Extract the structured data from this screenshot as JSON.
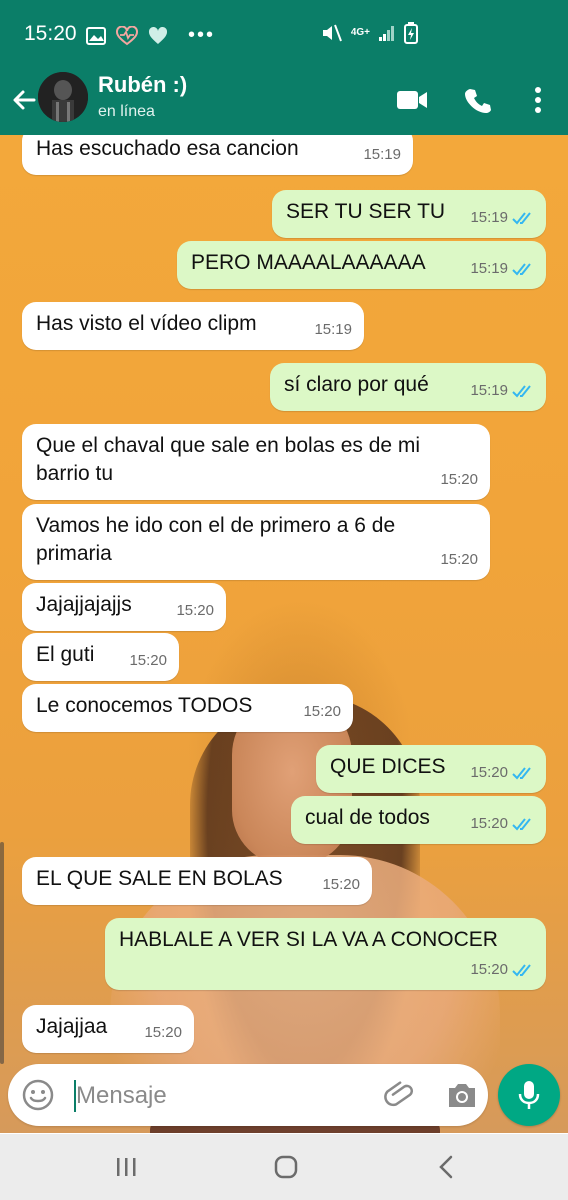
{
  "status_bar": {
    "time": "15:20",
    "network": "4G+",
    "colors": {
      "bar": "#0b7e68"
    }
  },
  "header": {
    "contact_name": "Rubén :)",
    "status": "en línea"
  },
  "messages": [
    {
      "direction": "in",
      "text": "Has escuchado esa cancion",
      "time": "15:19"
    },
    {
      "direction": "out",
      "text": "SER TU SER TU",
      "time": "15:19",
      "read": true
    },
    {
      "direction": "out",
      "text": "PERO MAAAALAAAAAA",
      "time": "15:19",
      "read": true
    },
    {
      "direction": "in",
      "text": "Has visto el vídeo clipm",
      "time": "15:19"
    },
    {
      "direction": "out",
      "text": "sí claro por qué",
      "time": "15:19",
      "read": true
    },
    {
      "direction": "in",
      "text": "Que el chaval que sale en bolas es de mi barrio tu",
      "time": "15:20"
    },
    {
      "direction": "in",
      "text": "Vamos he ido con el de primero a 6 de primaria",
      "time": "15:20"
    },
    {
      "direction": "in",
      "text": "Jajajjajajjs",
      "time": "15:20"
    },
    {
      "direction": "in",
      "text": "El guti",
      "time": "15:20"
    },
    {
      "direction": "in",
      "text": "Le conocemos TODOS",
      "time": "15:20"
    },
    {
      "direction": "out",
      "text": "QUE DICES",
      "time": "15:20",
      "read": true
    },
    {
      "direction": "out",
      "text": "cual de todos",
      "time": "15:20",
      "read": true
    },
    {
      "direction": "in",
      "text": "EL QUE SALE EN BOLAS",
      "time": "15:20"
    },
    {
      "direction": "out",
      "text": "HABLALE A VER SI LA VA A CONOCER",
      "time": "15:20",
      "read": true
    },
    {
      "direction": "in",
      "text": "Jajajjaa",
      "time": "15:20"
    }
  ],
  "composer": {
    "placeholder": "Mensaje"
  },
  "icons": {
    "header": [
      "back-arrow-icon",
      "video-call-icon",
      "phone-icon",
      "more-vert-icon"
    ],
    "composer": [
      "emoji-icon",
      "attach-icon",
      "camera-icon",
      "mic-icon"
    ],
    "nav": [
      "recents-icon",
      "home-icon",
      "back-icon"
    ]
  },
  "colors": {
    "header": "#0b7e68",
    "outgoing_bubble": "#dcf8c6",
    "incoming_bubble": "#ffffff",
    "read_ticks": "#34b7f1",
    "mic_button": "#00a884"
  }
}
